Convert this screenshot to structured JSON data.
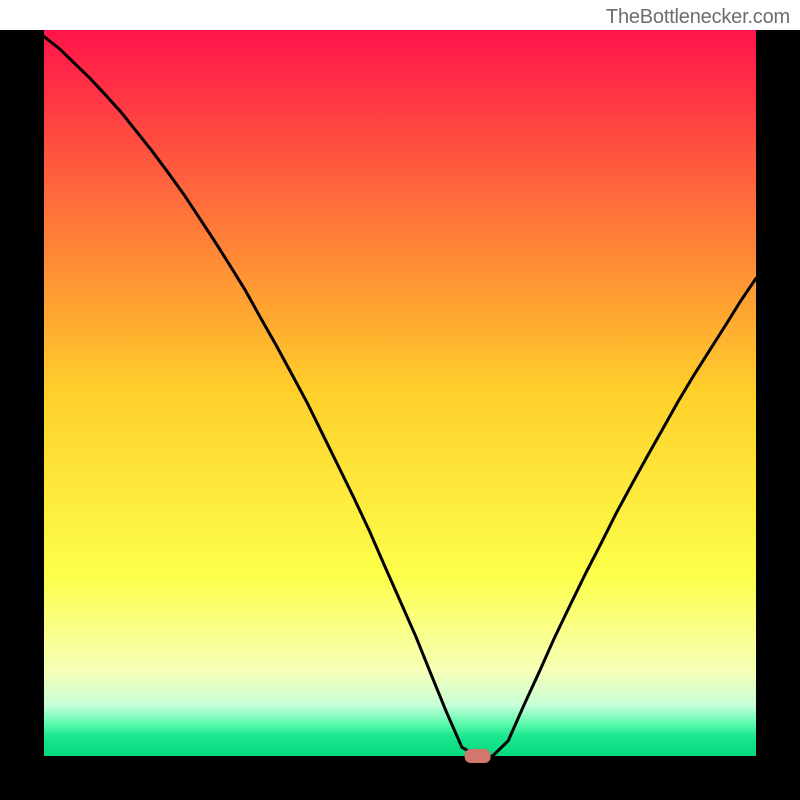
{
  "attribution": "TheBottlenecker.com",
  "chart_data": {
    "type": "line",
    "title": "",
    "xlabel": "",
    "ylabel": "",
    "xlim": [
      0,
      100
    ],
    "ylim": [
      0,
      100
    ],
    "x": [
      0,
      2.2,
      4.3,
      6.5,
      8.7,
      10.9,
      13.0,
      15.2,
      17.4,
      19.6,
      21.7,
      23.9,
      26.1,
      28.3,
      30.4,
      32.6,
      34.8,
      37.0,
      39.1,
      41.3,
      43.5,
      45.7,
      47.8,
      50.0,
      52.2,
      54.3,
      56.5,
      58.7,
      60.9,
      63.0,
      65.2,
      67.4,
      69.6,
      71.7,
      73.9,
      76.1,
      78.3,
      80.4,
      82.6,
      84.8,
      87.0,
      89.1,
      91.3,
      93.5,
      95.7,
      97.8,
      100.0
    ],
    "values": [
      99.1,
      97.4,
      95.4,
      93.3,
      91.0,
      88.6,
      86.0,
      83.3,
      80.4,
      77.4,
      74.3,
      71.0,
      67.6,
      64.1,
      60.4,
      56.6,
      52.6,
      48.6,
      44.4,
      40.0,
      35.6,
      31.0,
      26.3,
      21.4,
      16.5,
      11.4,
      6.1,
      1.2,
      0.0,
      0.0,
      2.1,
      7.0,
      11.7,
      16.3,
      20.8,
      25.2,
      29.4,
      33.5,
      37.5,
      41.4,
      45.2,
      48.9,
      52.5,
      55.9,
      59.3,
      62.6,
      65.8
    ],
    "marker": {
      "index": 28,
      "x": 60.9,
      "y": 0.0
    },
    "gradient_stops": [
      {
        "offset": 0.0,
        "color": "#ff134a"
      },
      {
        "offset": 0.5,
        "color": "#ffd02a"
      },
      {
        "offset": 0.75,
        "color": "#fcff4a"
      },
      {
        "offset": 0.88,
        "color": "#f7ffb4"
      },
      {
        "offset": 0.93,
        "color": "#c8ffd8"
      },
      {
        "offset": 0.955,
        "color": "#5efab0"
      },
      {
        "offset": 0.972,
        "color": "#1de78e"
      },
      {
        "offset": 1.0,
        "color": "#04da7d"
      }
    ]
  }
}
